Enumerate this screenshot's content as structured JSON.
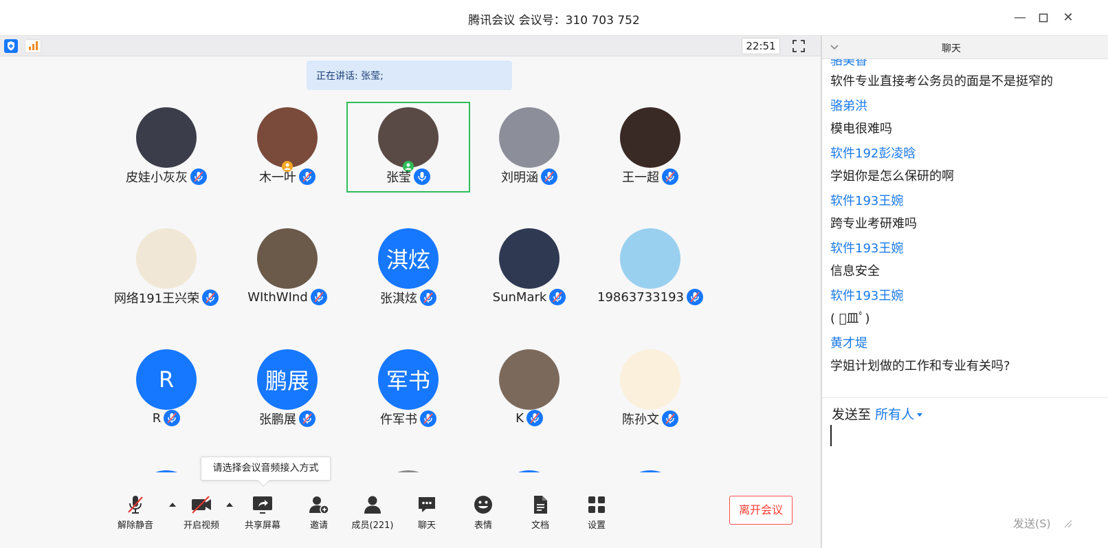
{
  "window": {
    "title": "腾讯会议 会议号：310 703 752"
  },
  "strip": {
    "timer": "22:51"
  },
  "main": {
    "speaking_text": "正在讲话: 张莹;",
    "participants": [
      {
        "name": "皮娃小灰灰",
        "avatar_text": "",
        "avatar_color": "#3b3d4a"
      },
      {
        "name": "木一叶",
        "avatar_text": "",
        "avatar_color": "#7a4a3a",
        "badge": "host"
      },
      {
        "name": "张莹",
        "avatar_text": "",
        "avatar_color": "#5a4a45",
        "badge": "cohost",
        "active": true
      },
      {
        "name": "刘明涵",
        "avatar_text": "",
        "avatar_color": "#8c8f9a"
      },
      {
        "name": "王一超",
        "avatar_text": "",
        "avatar_color": "#3a2a25"
      },
      {
        "name": "网络191王兴荣",
        "avatar_text": "",
        "avatar_color": "#f1e7d6"
      },
      {
        "name": "WIthWInd",
        "avatar_text": "",
        "avatar_color": "#6b5a4a"
      },
      {
        "name": "张淇炫",
        "avatar_text": "淇炫",
        "avatar_color": "#1677ff"
      },
      {
        "name": "SunMark",
        "avatar_text": "",
        "avatar_color": "#2f3a52"
      },
      {
        "name": "19863733193",
        "avatar_text": "",
        "avatar_color": "#9ad0ef"
      },
      {
        "name": "R",
        "avatar_text": "R",
        "avatar_color": "#1677ff"
      },
      {
        "name": "张鹏展",
        "avatar_text": "鹏展",
        "avatar_color": "#1677ff"
      },
      {
        "name": "仵军书",
        "avatar_text": "军书",
        "avatar_color": "#1677ff"
      },
      {
        "name": "K",
        "avatar_text": "",
        "avatar_color": "#7b6a5c"
      },
      {
        "name": "陈孙文",
        "avatar_text": "",
        "avatar_color": "#fbf0dc"
      }
    ]
  },
  "tooltip": {
    "text": "请选择会议音频接入方式"
  },
  "controls": {
    "unmute": "解除静音",
    "video": "开启视频",
    "share": "共享屏幕",
    "invite": "邀请",
    "members": "成员(221)",
    "chat": "聊天",
    "emoji": "表情",
    "docs": "文档",
    "settings": "设置",
    "leave": "离开会议"
  },
  "chat": {
    "title": "聊天",
    "partial_sender": "骆美香",
    "messages": [
      {
        "sender": "",
        "text": "软件专业直接考公务员的面是不是挺窄的"
      },
      {
        "sender": "骆弟洪",
        "text": "模电很难吗"
      },
      {
        "sender": "软件192彭凌晗",
        "text": "学姐你是怎么保研的啊"
      },
      {
        "sender": "软件193王婉",
        "text": "跨专业考研难吗"
      },
      {
        "sender": "软件193王婉",
        "text": "信息安全"
      },
      {
        "sender": "软件193王婉",
        "text": "( ﾟ皿ﾟ)"
      },
      {
        "sender": "黄才堤",
        "text": "学姐计划做的工作和专业有关吗?"
      }
    ],
    "send_to_label": "发送至",
    "send_to_target": "所有人",
    "send_button": "发送(S)"
  },
  "colors": {
    "accent": "#1677ff",
    "active_border": "#2ebd59",
    "leave": "#ff3b30",
    "chat_sender": "#1a7ae8"
  }
}
